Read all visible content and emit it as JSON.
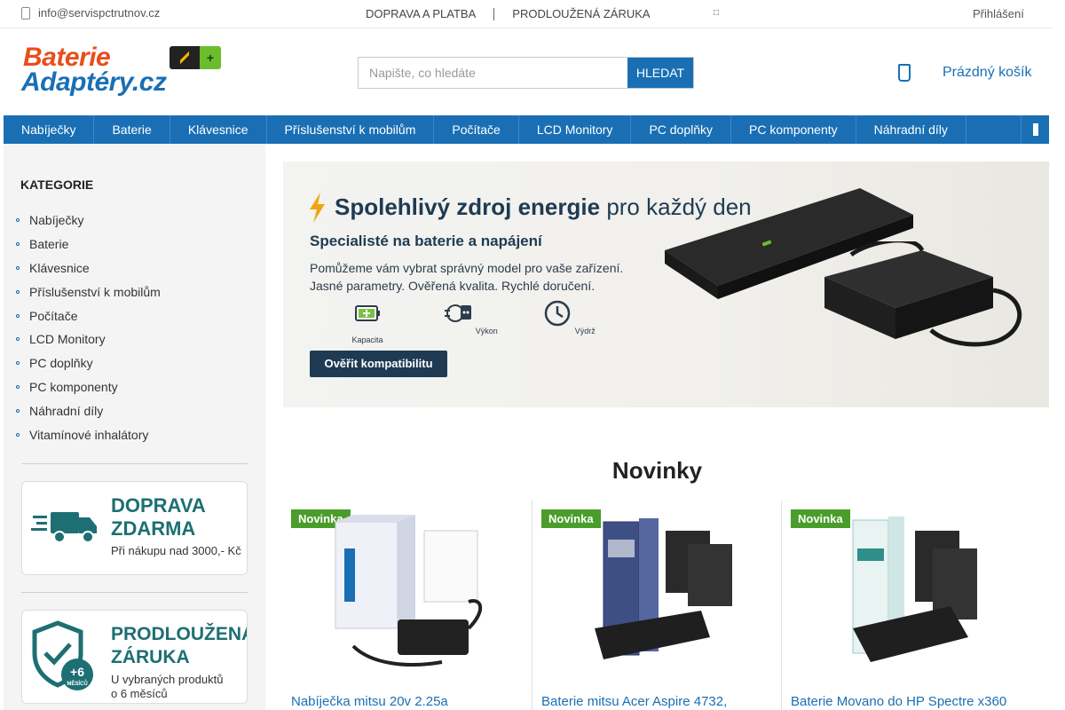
{
  "topbar": {
    "email": "info@servispctrutnov.cz",
    "links": [
      "DOPRAVA A PLATBA",
      "PRODLOUŽENÁ ZÁRUKA"
    ],
    "lang_icon": "□",
    "login": "Přihlášení"
  },
  "logo": {
    "line1": "Baterie",
    "line2": "Adaptéry.cz",
    "plus": "+"
  },
  "search": {
    "placeholder": "Napište, co hledáte",
    "button": "HLEDAT"
  },
  "cart": {
    "label": "Prázdný košík"
  },
  "nav": [
    "Nabíječky",
    "Baterie",
    "Klávesnice",
    "Příslušenství k mobilům",
    "Počítače",
    "LCD Monitory",
    "PC doplňky",
    "PC komponenty",
    "Náhradní díly"
  ],
  "sidebar": {
    "title": "KATEGORIE",
    "items": [
      "Nabíječky",
      "Baterie",
      "Klávesnice",
      "Příslušenství k mobilům",
      "Počítače",
      "LCD Monitory",
      "PC doplňky",
      "PC komponenty",
      "Náhradní díly",
      "Vitamínové inhalátory"
    ],
    "promo1": {
      "title1": "DOPRAVA",
      "title2": "ZDARMA",
      "text": "Při nákupu nad 3000,- Kč"
    },
    "promo2": {
      "title1": "PRODLOUŽENÁ",
      "title2": "ZÁRUKA",
      "badge1": "+6",
      "badge2": "MĚSÍCŮ",
      "text1": "U vybraných produktů",
      "text2": "o 6 měsíců"
    }
  },
  "banner": {
    "headline_bold": "Spolehlivý zdroj energie",
    "headline_light": "pro každý den",
    "sub": "Specialisté na baterie a napájení",
    "desc1": "Pomůžeme vám vybrat správný model pro vaše zařízení.",
    "desc2": "Jasné parametry.  Ověřená kvalita.  Rychlé doručení.",
    "features": [
      "Kapacita",
      "Výkon",
      "Výdrž"
    ],
    "cta": "Ověřit kompatibilitu"
  },
  "novinky": {
    "title": "Novinky",
    "products": [
      {
        "badge": "Novinka",
        "name": "Nabíječka mitsu 20v 2.25a"
      },
      {
        "badge": "Novinka",
        "name": "Baterie mitsu Acer Aspire 4732,"
      },
      {
        "badge": "Novinka",
        "name": "Baterie Movano do HP Spectre x360"
      }
    ]
  },
  "colors": {
    "brand_blue": "#1a6fb4",
    "brand_orange": "#e84e1b",
    "badge_green": "#4a9d2a"
  }
}
